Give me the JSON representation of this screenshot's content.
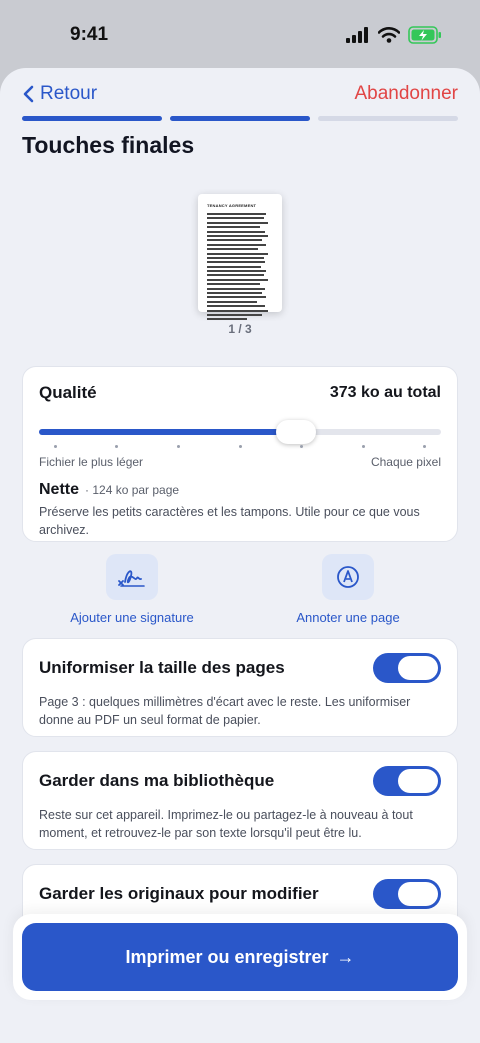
{
  "status_bar": {
    "time": "9:41"
  },
  "nav": {
    "back_label": "Retour",
    "abandon_label": "Abandonner"
  },
  "progress": {
    "steps_total": 3,
    "steps_done": 2
  },
  "page_title": "Touches finales",
  "preview": {
    "doc_heading": "TENANCY AGREEMENT",
    "page_indicator": "1 / 3"
  },
  "quality": {
    "label": "Qualité",
    "total": "373 ko au total",
    "slider_fraction": 0.64,
    "tick_count": 7,
    "min_label": "Fichier le plus léger",
    "max_label": "Chaque pixel",
    "level_name": "Nette",
    "per_page": "· 124 ko par page",
    "description": "Préserve les petits caractères et les tampons. Utile pour ce que vous archivez."
  },
  "actions": {
    "signature_label": "Ajouter une signature",
    "annotate_label": "Annoter une page"
  },
  "toggles": [
    {
      "title": "Uniformiser la taille des pages",
      "description": "Page 3 : quelques millimètres d'écart avec le reste. Les uniformiser donne au PDF un seul format de papier.",
      "on": true
    },
    {
      "title": "Garder dans ma bibliothèque",
      "description": "Reste sur cet appareil. Imprimez-le ou partagez-le à nouveau à tout moment, et retrouvez-le par son texte lorsqu'il peut être lu.",
      "on": true
    },
    {
      "title": "Garder les originaux pour modifier",
      "description": "",
      "on": true
    }
  ],
  "primary_action": {
    "label": "Imprimer ou enregistrer",
    "arrow": "→"
  },
  "colors": {
    "accent": "#2a57c9",
    "danger": "#e14545",
    "battery": "#34c759"
  }
}
